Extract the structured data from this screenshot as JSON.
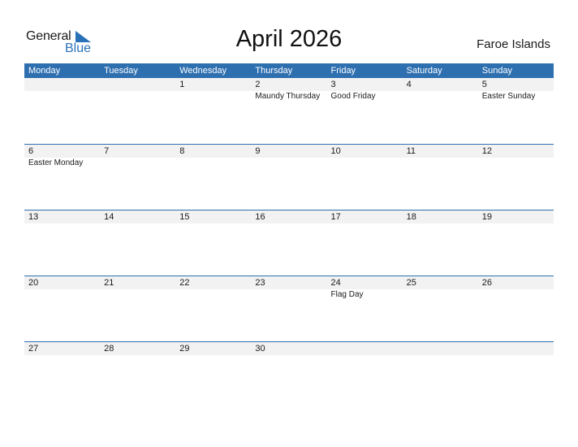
{
  "logo": {
    "text_general": "General",
    "text_blue": "Blue"
  },
  "title": "April 2026",
  "country": "Faroe Islands",
  "colors": {
    "header": "#2e6fb0",
    "date_band": "#f2f2f2",
    "logo_blue": "#2a72b8"
  },
  "weekdays": [
    "Monday",
    "Tuesday",
    "Wednesday",
    "Thursday",
    "Friday",
    "Saturday",
    "Sunday"
  ],
  "weeks": [
    [
      {
        "day": "",
        "holiday": ""
      },
      {
        "day": "",
        "holiday": ""
      },
      {
        "day": "1",
        "holiday": ""
      },
      {
        "day": "2",
        "holiday": "Maundy Thursday"
      },
      {
        "day": "3",
        "holiday": "Good Friday"
      },
      {
        "day": "4",
        "holiday": ""
      },
      {
        "day": "5",
        "holiday": "Easter Sunday"
      }
    ],
    [
      {
        "day": "6",
        "holiday": "Easter Monday"
      },
      {
        "day": "7",
        "holiday": ""
      },
      {
        "day": "8",
        "holiday": ""
      },
      {
        "day": "9",
        "holiday": ""
      },
      {
        "day": "10",
        "holiday": ""
      },
      {
        "day": "11",
        "holiday": ""
      },
      {
        "day": "12",
        "holiday": ""
      }
    ],
    [
      {
        "day": "13",
        "holiday": ""
      },
      {
        "day": "14",
        "holiday": ""
      },
      {
        "day": "15",
        "holiday": ""
      },
      {
        "day": "16",
        "holiday": ""
      },
      {
        "day": "17",
        "holiday": ""
      },
      {
        "day": "18",
        "holiday": ""
      },
      {
        "day": "19",
        "holiday": ""
      }
    ],
    [
      {
        "day": "20",
        "holiday": ""
      },
      {
        "day": "21",
        "holiday": ""
      },
      {
        "day": "22",
        "holiday": ""
      },
      {
        "day": "23",
        "holiday": ""
      },
      {
        "day": "24",
        "holiday": "Flag Day"
      },
      {
        "day": "25",
        "holiday": ""
      },
      {
        "day": "26",
        "holiday": ""
      }
    ],
    [
      {
        "day": "27",
        "holiday": ""
      },
      {
        "day": "28",
        "holiday": ""
      },
      {
        "day": "29",
        "holiday": ""
      },
      {
        "day": "30",
        "holiday": ""
      },
      {
        "day": "",
        "holiday": ""
      },
      {
        "day": "",
        "holiday": ""
      },
      {
        "day": "",
        "holiday": ""
      }
    ]
  ]
}
